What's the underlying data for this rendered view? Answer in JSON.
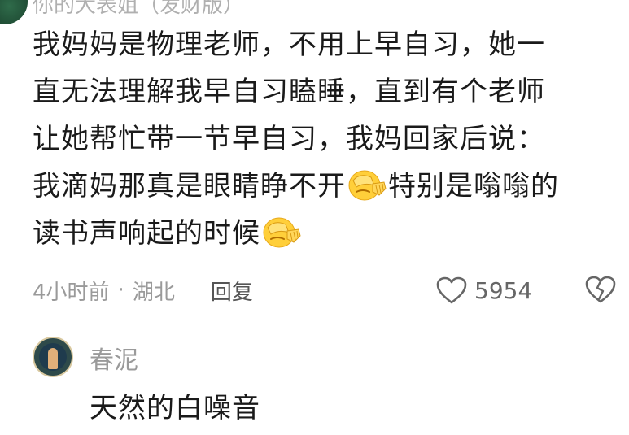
{
  "top_comment": {
    "author": "你的大表姐（发财版）",
    "lines": [
      "我妈妈是物理老师，不用上早自习，她一",
      "直无法理解我早自习瞌睡，直到有个老师",
      "让她帮忙带一节早自习，我妈回家后说：",
      {
        "a": "我滴妈那真是眼睛睁不开",
        "b": "特别是嗡嗡的"
      },
      {
        "a": "读书声响起的时候"
      }
    ],
    "emoji_icon": "facepalm-emoji",
    "time": "4小时前",
    "separator": "·",
    "location": "湖北",
    "reply_label": "回复",
    "likes": "5954"
  },
  "reply": {
    "author": "春泥",
    "text": "天然的白噪音"
  },
  "colors": {
    "text": "#1a1a1a",
    "meta": "#9a9a9a",
    "emoji_yellow": "#ffcf3a"
  }
}
